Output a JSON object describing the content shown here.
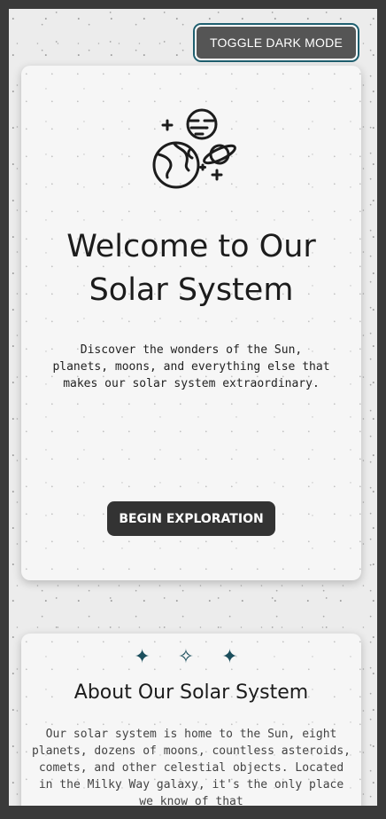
{
  "header": {
    "toggle_label": "TOGGLE DARK MODE"
  },
  "hero": {
    "icon": "planets-illustration-icon",
    "title": "Welcome to Our\nSolar System",
    "description": "Discover the wonders of the Sun, planets, moons, and everything else that makes our solar system extraordinary.",
    "cta_label": "BEGIN EXPLORATION"
  },
  "about": {
    "stars": [
      "✦",
      "✧",
      "✦"
    ],
    "title": "About Our Solar System",
    "body": "Our solar system is home to the Sun, eight planets, dozens of moons, countless asteroids, comets, and other celestial objects. Located in the Milky Way galaxy, it's the only place we know of that"
  },
  "colors": {
    "page_background": "#ececec",
    "card_background": "#f6f6f6",
    "toggle_background": "#555555",
    "toggle_outline": "#1f5f6f",
    "cta_background": "#333333",
    "accent": "#1b4e5c"
  }
}
